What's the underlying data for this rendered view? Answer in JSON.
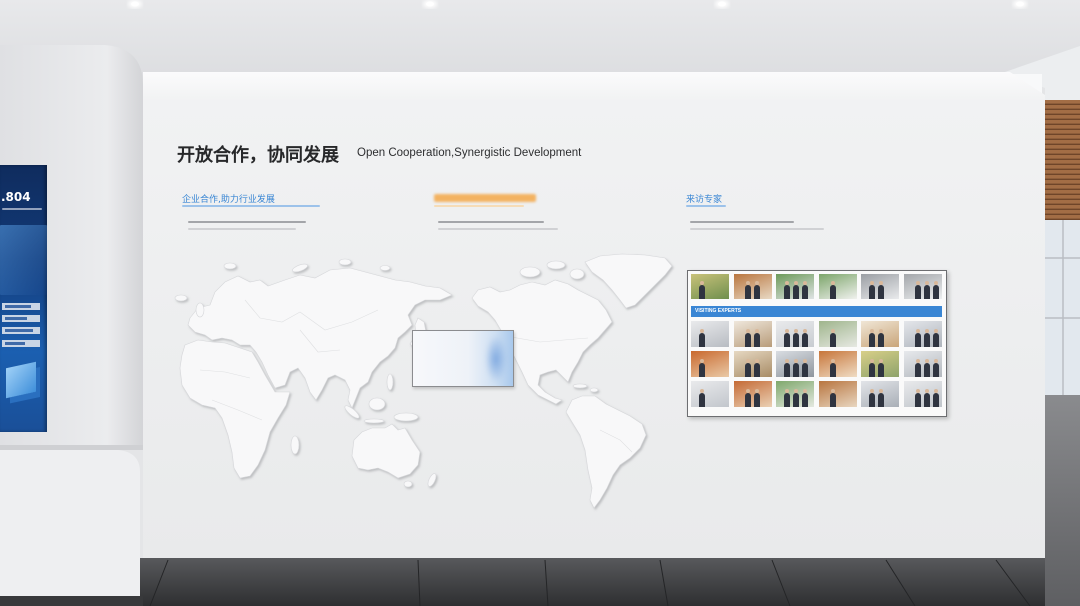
{
  "scene": {
    "accent_blue": "#3a86d4",
    "accent_orange": "#f3b261"
  },
  "wall": {
    "title_cn": "开放合作，协同发展",
    "title_en": "Open Cooperation,Synergistic Development"
  },
  "columns": [
    {
      "heading": "企业合作,助力行业发展"
    },
    {
      "heading": "来访专家"
    }
  ],
  "left_screen": {
    "figure": ".804"
  },
  "photo_wall": {
    "band_label": "VISITING EXPERTS"
  }
}
